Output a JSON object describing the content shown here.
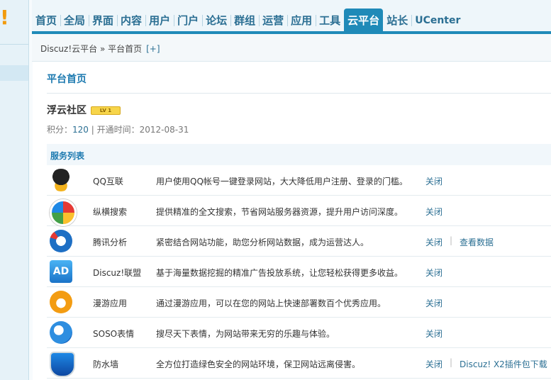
{
  "nav": {
    "items": [
      "首页",
      "全局",
      "界面",
      "内容",
      "用户",
      "门户",
      "论坛",
      "群组",
      "运营",
      "应用",
      "工具",
      "云平台",
      "站长",
      "UCenter"
    ],
    "active": "云平台"
  },
  "breadcrumb": {
    "path": "Discuz!云平台 » 平台首页",
    "add": "[+]"
  },
  "page": {
    "title": "平台首页",
    "site_name": "浮云社区",
    "level_badge": "LV 1",
    "meta_label": "积分：",
    "meta_points": "120",
    "meta_rest": " | 开通时间：2012-08-31",
    "section": "服务列表"
  },
  "services": [
    {
      "icon": "qq-penguin-icon",
      "name": "QQ互联",
      "desc": "用户使用QQ帐号一键登录网站，大大降低用户注册、登录的门槛。",
      "action": "关闭",
      "action2": ""
    },
    {
      "icon": "soso-search-icon",
      "name": "纵横搜索",
      "desc": "提供精准的全文搜索，节省网站服务器资源，提升用户访问深度。",
      "action": "关闭",
      "action2": ""
    },
    {
      "icon": "tencent-analytics-icon",
      "name": "腾讯分析",
      "desc": "紧密结合网站功能，助您分析网站数据，成为运营达人。",
      "action": "关闭",
      "action2": "查看数据"
    },
    {
      "icon": "ad-union-icon",
      "name": "Discuz!联盟",
      "desc": "基于海量数据挖掘的精准广告投放系统，让您轻松获得更多收益。",
      "action": "关闭",
      "action2": ""
    },
    {
      "icon": "manyou-app-icon",
      "name": "漫游应用",
      "desc": "通过漫游应用，可以在您的网站上快速部署数百个优秀应用。",
      "action": "关闭",
      "action2": ""
    },
    {
      "icon": "soso-emoticon-icon",
      "name": "SOSO表情",
      "desc": "搜尽天下表情，为网站带来无穷的乐趣与体验。",
      "action": "关闭",
      "action2": ""
    },
    {
      "icon": "firewall-shield-icon",
      "name": "防水墙",
      "desc": "全方位打造绿色安全的网站环境，保卫网站远离侵害。",
      "action": "关闭",
      "action2": "Discuz! X2插件包下载"
    }
  ],
  "colors": {
    "accent": "#1f8ab8",
    "link": "#2b6f93"
  }
}
